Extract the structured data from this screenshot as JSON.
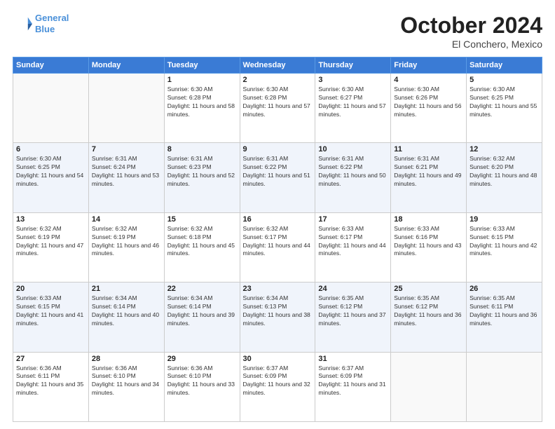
{
  "header": {
    "logo_line1": "General",
    "logo_line2": "Blue",
    "month": "October 2024",
    "location": "El Conchero, Mexico"
  },
  "weekdays": [
    "Sunday",
    "Monday",
    "Tuesday",
    "Wednesday",
    "Thursday",
    "Friday",
    "Saturday"
  ],
  "weeks": [
    [
      {
        "day": "",
        "info": ""
      },
      {
        "day": "",
        "info": ""
      },
      {
        "day": "1",
        "info": "Sunrise: 6:30 AM\nSunset: 6:28 PM\nDaylight: 11 hours and 58 minutes."
      },
      {
        "day": "2",
        "info": "Sunrise: 6:30 AM\nSunset: 6:28 PM\nDaylight: 11 hours and 57 minutes."
      },
      {
        "day": "3",
        "info": "Sunrise: 6:30 AM\nSunset: 6:27 PM\nDaylight: 11 hours and 57 minutes."
      },
      {
        "day": "4",
        "info": "Sunrise: 6:30 AM\nSunset: 6:26 PM\nDaylight: 11 hours and 56 minutes."
      },
      {
        "day": "5",
        "info": "Sunrise: 6:30 AM\nSunset: 6:25 PM\nDaylight: 11 hours and 55 minutes."
      }
    ],
    [
      {
        "day": "6",
        "info": "Sunrise: 6:30 AM\nSunset: 6:25 PM\nDaylight: 11 hours and 54 minutes."
      },
      {
        "day": "7",
        "info": "Sunrise: 6:31 AM\nSunset: 6:24 PM\nDaylight: 11 hours and 53 minutes."
      },
      {
        "day": "8",
        "info": "Sunrise: 6:31 AM\nSunset: 6:23 PM\nDaylight: 11 hours and 52 minutes."
      },
      {
        "day": "9",
        "info": "Sunrise: 6:31 AM\nSunset: 6:22 PM\nDaylight: 11 hours and 51 minutes."
      },
      {
        "day": "10",
        "info": "Sunrise: 6:31 AM\nSunset: 6:22 PM\nDaylight: 11 hours and 50 minutes."
      },
      {
        "day": "11",
        "info": "Sunrise: 6:31 AM\nSunset: 6:21 PM\nDaylight: 11 hours and 49 minutes."
      },
      {
        "day": "12",
        "info": "Sunrise: 6:32 AM\nSunset: 6:20 PM\nDaylight: 11 hours and 48 minutes."
      }
    ],
    [
      {
        "day": "13",
        "info": "Sunrise: 6:32 AM\nSunset: 6:19 PM\nDaylight: 11 hours and 47 minutes."
      },
      {
        "day": "14",
        "info": "Sunrise: 6:32 AM\nSunset: 6:19 PM\nDaylight: 11 hours and 46 minutes."
      },
      {
        "day": "15",
        "info": "Sunrise: 6:32 AM\nSunset: 6:18 PM\nDaylight: 11 hours and 45 minutes."
      },
      {
        "day": "16",
        "info": "Sunrise: 6:32 AM\nSunset: 6:17 PM\nDaylight: 11 hours and 44 minutes."
      },
      {
        "day": "17",
        "info": "Sunrise: 6:33 AM\nSunset: 6:17 PM\nDaylight: 11 hours and 44 minutes."
      },
      {
        "day": "18",
        "info": "Sunrise: 6:33 AM\nSunset: 6:16 PM\nDaylight: 11 hours and 43 minutes."
      },
      {
        "day": "19",
        "info": "Sunrise: 6:33 AM\nSunset: 6:15 PM\nDaylight: 11 hours and 42 minutes."
      }
    ],
    [
      {
        "day": "20",
        "info": "Sunrise: 6:33 AM\nSunset: 6:15 PM\nDaylight: 11 hours and 41 minutes."
      },
      {
        "day": "21",
        "info": "Sunrise: 6:34 AM\nSunset: 6:14 PM\nDaylight: 11 hours and 40 minutes."
      },
      {
        "day": "22",
        "info": "Sunrise: 6:34 AM\nSunset: 6:14 PM\nDaylight: 11 hours and 39 minutes."
      },
      {
        "day": "23",
        "info": "Sunrise: 6:34 AM\nSunset: 6:13 PM\nDaylight: 11 hours and 38 minutes."
      },
      {
        "day": "24",
        "info": "Sunrise: 6:35 AM\nSunset: 6:12 PM\nDaylight: 11 hours and 37 minutes."
      },
      {
        "day": "25",
        "info": "Sunrise: 6:35 AM\nSunset: 6:12 PM\nDaylight: 11 hours and 36 minutes."
      },
      {
        "day": "26",
        "info": "Sunrise: 6:35 AM\nSunset: 6:11 PM\nDaylight: 11 hours and 36 minutes."
      }
    ],
    [
      {
        "day": "27",
        "info": "Sunrise: 6:36 AM\nSunset: 6:11 PM\nDaylight: 11 hours and 35 minutes."
      },
      {
        "day": "28",
        "info": "Sunrise: 6:36 AM\nSunset: 6:10 PM\nDaylight: 11 hours and 34 minutes."
      },
      {
        "day": "29",
        "info": "Sunrise: 6:36 AM\nSunset: 6:10 PM\nDaylight: 11 hours and 33 minutes."
      },
      {
        "day": "30",
        "info": "Sunrise: 6:37 AM\nSunset: 6:09 PM\nDaylight: 11 hours and 32 minutes."
      },
      {
        "day": "31",
        "info": "Sunrise: 6:37 AM\nSunset: 6:09 PM\nDaylight: 11 hours and 31 minutes."
      },
      {
        "day": "",
        "info": ""
      },
      {
        "day": "",
        "info": ""
      }
    ]
  ]
}
